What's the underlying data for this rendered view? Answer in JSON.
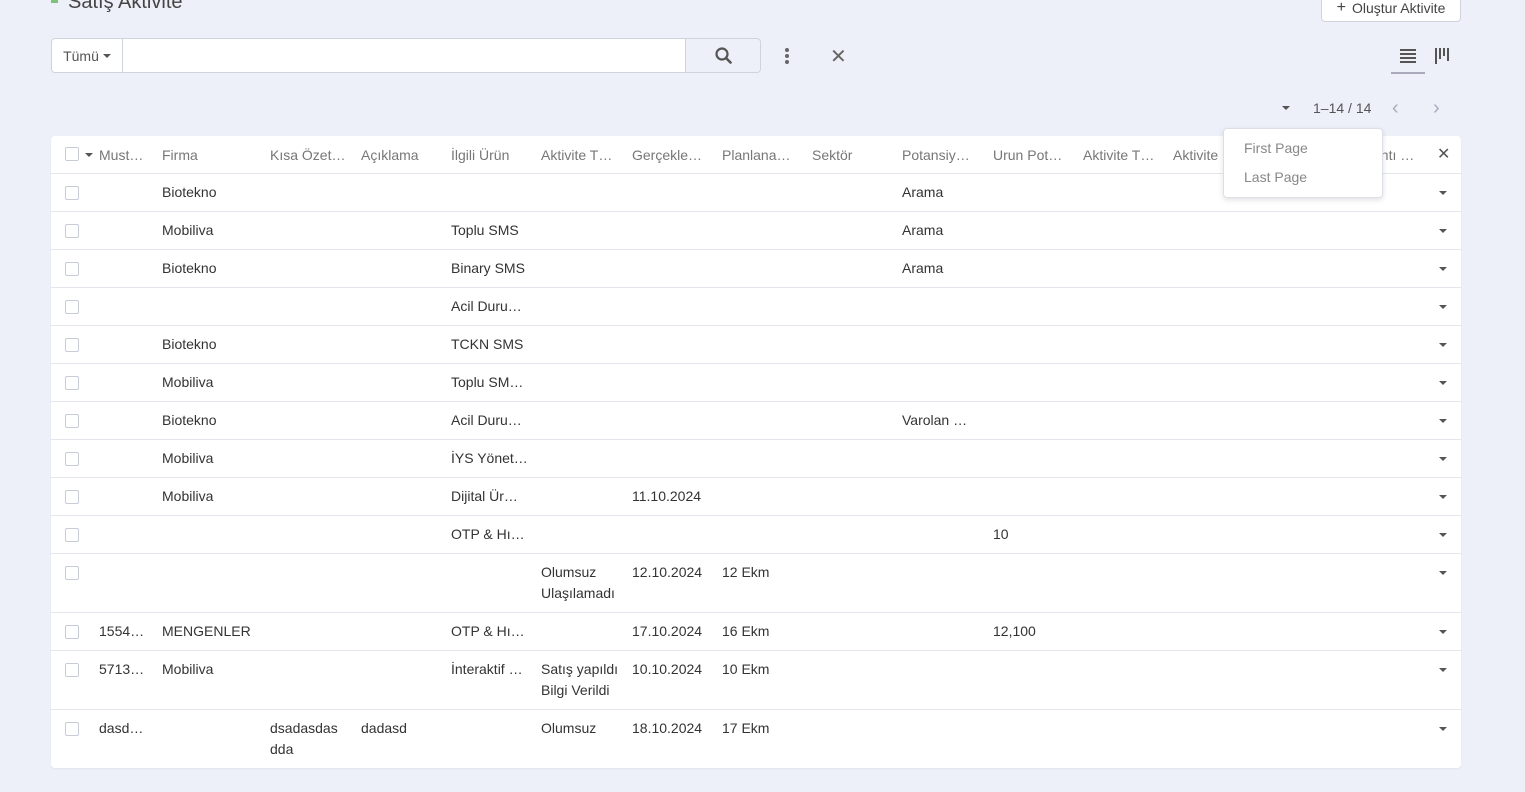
{
  "header": {
    "title": "Satış Aktivite",
    "create_label": "Oluştur Aktivite",
    "create_icon": "plus-icon",
    "accent": "#7ec27a"
  },
  "search": {
    "filter_label": "Tümü",
    "value": "",
    "placeholder": ""
  },
  "pager": {
    "range": "1–14 / 14"
  },
  "pager_menu": {
    "first": "First Page",
    "last": "Last Page"
  },
  "table": {
    "columns": [
      "Must…",
      "Firma",
      "Kısa Özet…",
      "Açıklama",
      "İlgili Ürün",
      "Aktivite T…",
      "Gerçekle…",
      "Planlana…",
      "Sektör",
      "Potansiy…",
      "Urun Pot…",
      "Aktivite T…",
      "Aktivite",
      "antı …"
    ],
    "rows": [
      {
        "must": "",
        "firma": "Biotekno",
        "ozet": "",
        "aciklama": "",
        "urun": "",
        "tip": "",
        "gercek": "",
        "plan": "",
        "sektor": "",
        "potansiyel": "Arama",
        "urunpot": ""
      },
      {
        "must": "",
        "firma": "Mobiliva",
        "ozet": "",
        "aciklama": "",
        "urun": "Toplu SMS",
        "tip": "",
        "gercek": "",
        "plan": "",
        "sektor": "",
        "potansiyel": "Arama",
        "urunpot": ""
      },
      {
        "must": "",
        "firma": "Biotekno",
        "ozet": "",
        "aciklama": "",
        "urun": "Binary SMS",
        "tip": "",
        "gercek": "",
        "plan": "",
        "sektor": "",
        "potansiyel": "Arama",
        "urunpot": ""
      },
      {
        "must": "",
        "firma": "",
        "ozet": "",
        "aciklama": "",
        "urun": "Acil Duru…",
        "tip": "",
        "gercek": "",
        "plan": "",
        "sektor": "",
        "potansiyel": "",
        "urunpot": ""
      },
      {
        "must": "",
        "firma": "Biotekno",
        "ozet": "",
        "aciklama": "",
        "urun": "TCKN SMS",
        "tip": "",
        "gercek": "",
        "plan": "",
        "sektor": "",
        "potansiyel": "",
        "urunpot": ""
      },
      {
        "must": "",
        "firma": "Mobiliva",
        "ozet": "",
        "aciklama": "",
        "urun": "Toplu SM…",
        "tip": "",
        "gercek": "",
        "plan": "",
        "sektor": "",
        "potansiyel": "",
        "urunpot": ""
      },
      {
        "must": "",
        "firma": "Biotekno",
        "ozet": "",
        "aciklama": "",
        "urun": "Acil Duru…",
        "tip": "",
        "gercek": "",
        "plan": "",
        "sektor": "",
        "potansiyel": "Varolan …",
        "urunpot": ""
      },
      {
        "must": "",
        "firma": "Mobiliva",
        "ozet": "",
        "aciklama": "",
        "urun": "İYS Yönet…",
        "tip": "",
        "gercek": "",
        "plan": "",
        "sektor": "",
        "potansiyel": "",
        "urunpot": ""
      },
      {
        "must": "",
        "firma": "Mobiliva",
        "ozet": "",
        "aciklama": "",
        "urun": "Dijital Ür…",
        "tip": "",
        "gercek": "11.10.2024",
        "plan": "",
        "sektor": "",
        "potansiyel": "",
        "urunpot": ""
      },
      {
        "must": "",
        "firma": "",
        "ozet": "",
        "aciklama": "",
        "urun": "OTP & Hı…",
        "tip": "",
        "gercek": "",
        "plan": "",
        "sektor": "",
        "potansiyel": "",
        "urunpot": "10"
      },
      {
        "must": "",
        "firma": "",
        "ozet": "",
        "aciklama": "",
        "urun": "",
        "tip": "Olumsuz",
        "tip2": "Ulaşılamadı",
        "gercek": "12.10.2024",
        "plan": "12 Ekm",
        "sektor": "",
        "potansiyel": "",
        "urunpot": ""
      },
      {
        "must": "1554…",
        "firma": "MENGENLER",
        "ozet": "",
        "aciklama": "",
        "urun": "OTP & Hı…",
        "tip": "",
        "gercek": "17.10.2024",
        "plan": "16 Ekm",
        "sektor": "",
        "potansiyel": "",
        "urunpot": "12,100"
      },
      {
        "must": "5713…",
        "firma": "Mobiliva",
        "ozet": "",
        "aciklama": "",
        "urun": "İnteraktif …",
        "tip": "Satış yapıldı",
        "tip2": "Bilgi Verildi",
        "gercek": "10.10.2024",
        "plan": "10 Ekm",
        "sektor": "",
        "potansiyel": "",
        "urunpot": ""
      },
      {
        "must": "dasd…",
        "firma": "",
        "ozet": "dsadasdas",
        "ozet2": "dda",
        "aciklama": "dadasd",
        "urun": "",
        "tip": "Olumsuz",
        "gercek": "18.10.2024",
        "plan": "17 Ekm",
        "sektor": "",
        "potansiyel": "",
        "urunpot": ""
      }
    ]
  }
}
